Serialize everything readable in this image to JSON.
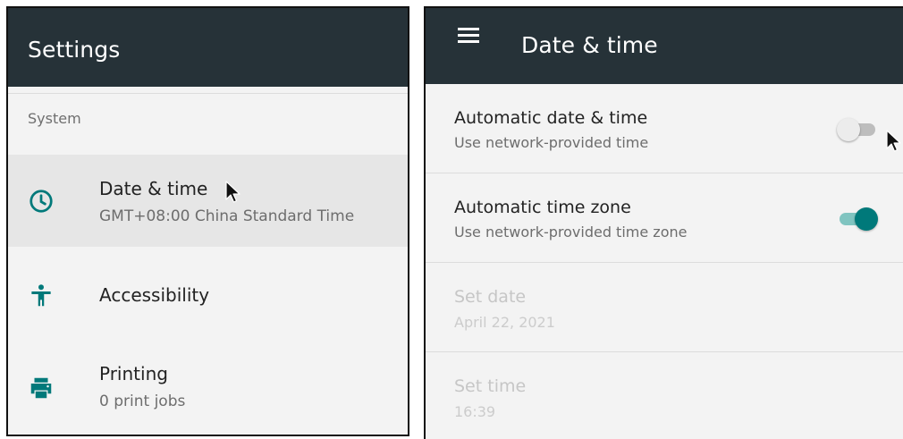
{
  "settings": {
    "title": "Settings",
    "section_header": "System",
    "items": [
      {
        "title": "Date & time",
        "subtitle": "GMT+08:00 China Standard Time",
        "icon": "clock-icon",
        "selected": true
      },
      {
        "title": "Accessibility",
        "subtitle": "",
        "icon": "accessibility-icon"
      },
      {
        "title": "Printing",
        "subtitle": "0 print jobs",
        "icon": "printer-icon"
      }
    ]
  },
  "date_time": {
    "title": "Date & time",
    "menu_icon": "menu-icon",
    "prefs": [
      {
        "title": "Automatic date & time",
        "subtitle": "Use network-provided time",
        "switch": "off"
      },
      {
        "title": "Automatic time zone",
        "subtitle": "Use network-provided time zone",
        "switch": "on"
      },
      {
        "title": "Set date",
        "subtitle": "April 22, 2021",
        "enabled": false
      },
      {
        "title": "Set time",
        "subtitle": "16:39",
        "enabled": false
      }
    ]
  },
  "colors": {
    "app_bar": "#263238",
    "accent": "#00797A",
    "background": "#F3F3F3",
    "selected_row": "#E6E6E6"
  }
}
